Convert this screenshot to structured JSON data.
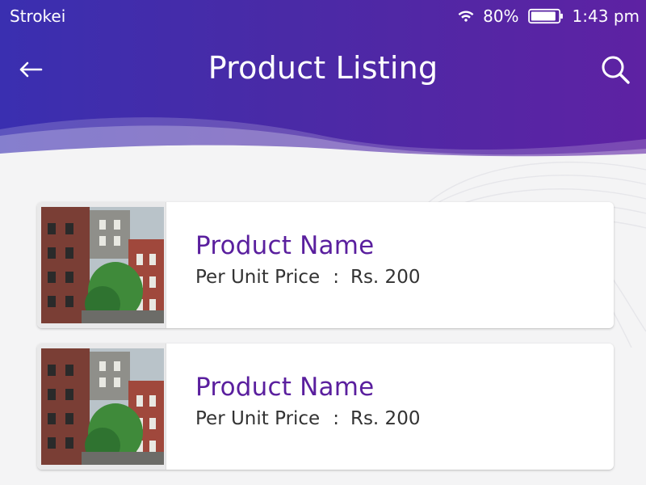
{
  "status_bar": {
    "carrier": "Strokei",
    "battery_percent": "80%",
    "time": "1:43 pm",
    "icons": [
      "wifi-icon",
      "battery-icon"
    ]
  },
  "toolbar": {
    "title": "Product Listing",
    "back_icon": "arrow-left-icon",
    "search_icon": "search-icon"
  },
  "colors": {
    "header_start": "#3a2fb0",
    "header_end": "#5e22a3",
    "product_name": "#5a1f9e",
    "background": "#f4f4f5"
  },
  "products": [
    {
      "name": "Product Name",
      "price_label": "Per Unit Price",
      "separator": ":",
      "price": "Rs. 200",
      "image": "building-photo"
    },
    {
      "name": "Product Name",
      "price_label": "Per Unit Price",
      "separator": ":",
      "price": "Rs. 200",
      "image": "building-photo"
    }
  ]
}
